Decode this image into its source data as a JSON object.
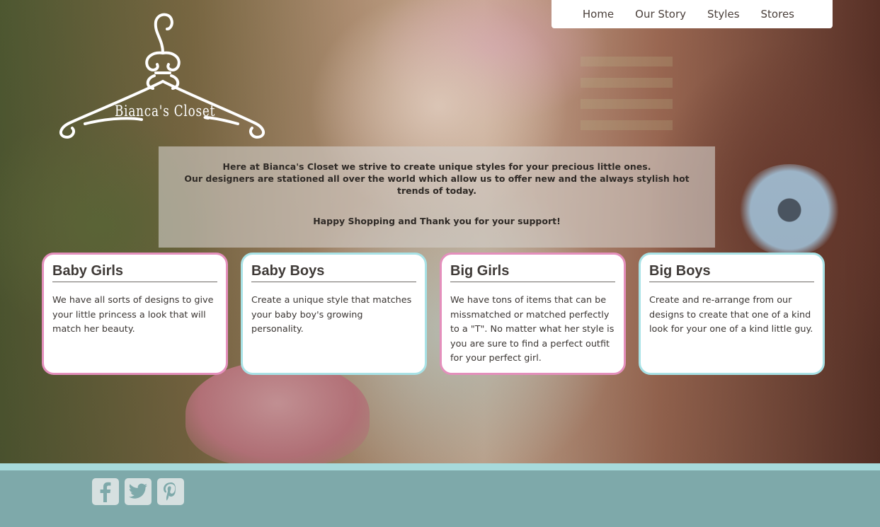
{
  "brand": {
    "logo_text": "Bianca's Closet"
  },
  "nav": {
    "items": [
      {
        "label": "Home"
      },
      {
        "label": "Our Story"
      },
      {
        "label": "Styles"
      },
      {
        "label": "Stores"
      }
    ]
  },
  "intro": {
    "line1": "Here at Bianca's Closet we strive to create unique styles for your precious little ones.",
    "line2": "Our designers are stationed all over the world which allow us to offer new and the always stylish hot trends of today.",
    "line3": "Happy Shopping and Thank you for your support!"
  },
  "categories": [
    {
      "title": "Baby Girls",
      "text": "We have all sorts of designs to give your little princess a look that will match her beauty.",
      "border_color": "#e48fbc"
    },
    {
      "title": "Baby Boys",
      "text": "Create a unique style that matches your baby boy's growing personality.",
      "border_color": "#a8e2e6"
    },
    {
      "title": "Big Girls",
      "text": "We have tons of items that can be missmatched or matched perfectly to a \"T\". No matter what her style is you are sure to find a perfect outfit for your perfect girl.",
      "border_color": "#e48fbc"
    },
    {
      "title": "Big Boys",
      "text": "Create and re-arrange from our designs to create that one of a kind look for your one of a kind little guy.",
      "border_color": "#a8e2e6"
    }
  ],
  "footer": {
    "social": [
      {
        "icon": "facebook-icon"
      },
      {
        "icon": "twitter-icon"
      },
      {
        "icon": "pinterest-icon"
      }
    ]
  },
  "colors": {
    "footer_bg": "#7ea9aa",
    "footer_accent": "#a7dadb",
    "pink_border": "#e48fbc",
    "blue_border": "#a8e2e6"
  }
}
